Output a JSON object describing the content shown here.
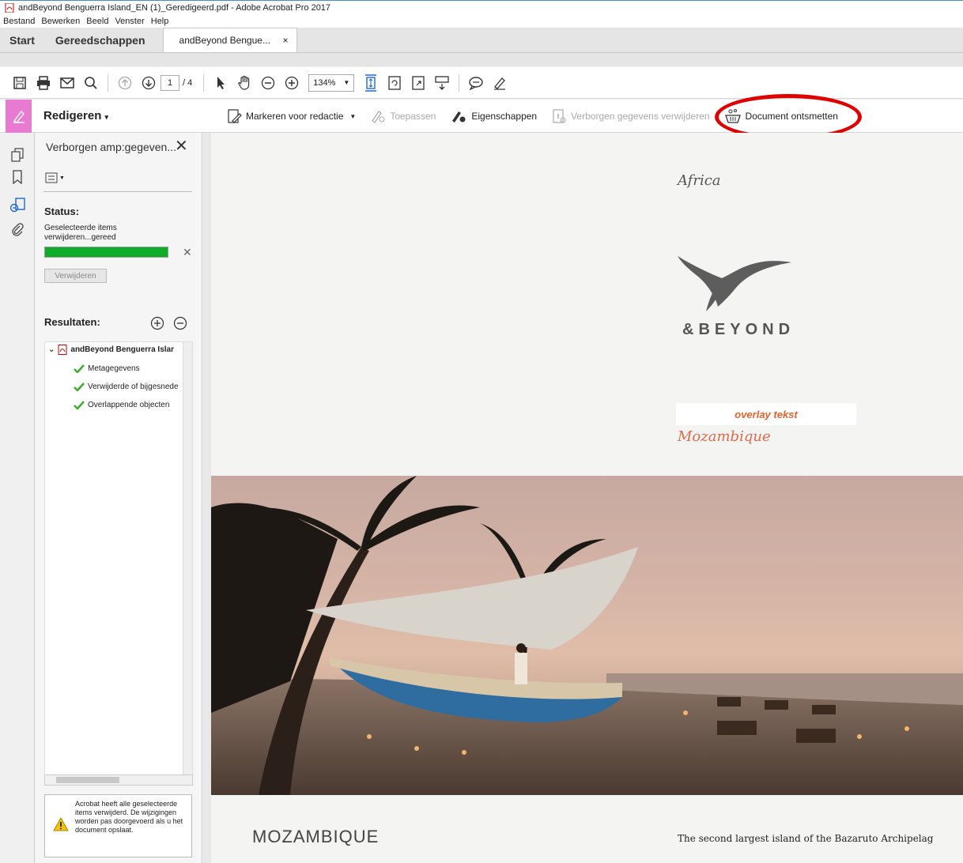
{
  "window": {
    "title": "andBeyond Benguerra Island_EN (1)_Geredigeerd.pdf - Adobe Acrobat Pro 2017"
  },
  "menu": {
    "items": [
      "Bestand",
      "Bewerken",
      "Beeld",
      "Venster",
      "Help"
    ]
  },
  "tabs": {
    "start": "Start",
    "tools": "Gereedschappen",
    "doc": "andBeyond Bengue...",
    "doc_close": "×"
  },
  "toolbar": {
    "page_current": "1",
    "page_total": "/ 4",
    "zoom": "134%"
  },
  "redact": {
    "mode_label": "Redigeren",
    "mark": "Markeren voor redactie",
    "apply": "Toepassen",
    "properties": "Eigenschappen",
    "remove_hidden": "Verborgen gegevens verwijderen",
    "sanitize": "Document ontsmetten"
  },
  "panel": {
    "title": "Verborgen amp:gegeven...",
    "status_label": "Status:",
    "status_text": "Geselecteerde items verwijderen...gereed",
    "progress": 1.0,
    "remove_button": "Verwijderen",
    "results_label": "Resultaten:",
    "tree_root": "andBeyond Benguerra Islar",
    "tree_items": [
      "Metagegevens",
      "Verwijderde of bijgesnede",
      "Overlappende objecten"
    ],
    "notice": "Acrobat heeft alle geselecteerde items verwijderd. De wijzigingen worden pas doorgevoerd als u het document opslaat."
  },
  "document": {
    "africa": "Africa",
    "logo_text": "&BEYOND",
    "overlay": "overlay tekst",
    "mozambique_script": "Mozambique",
    "heading": "MOZAMBIQUE",
    "body": "The second largest island of the Bazaruto Archipelag"
  },
  "colors": {
    "accent_pink": "#e87ad1",
    "progress_green": "#0fac2a",
    "highlight_red": "#e00000"
  }
}
